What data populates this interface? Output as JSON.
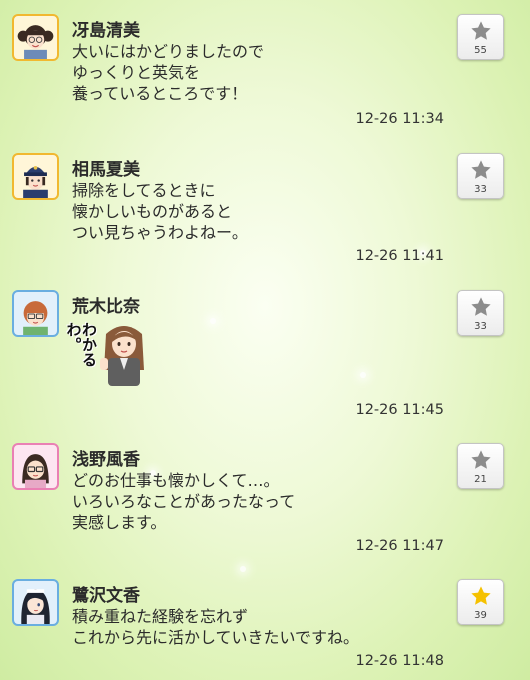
{
  "posts": [
    {
      "name": "冴島清美",
      "lines": [
        "大いにはかどりましたので",
        "ゆっくりと英気を",
        "養っているところです！"
      ],
      "time": "12-26 11:34",
      "likes": "55",
      "liked": false,
      "avatar_icon": "avatar-glasses-twintails"
    },
    {
      "name": "相馬夏美",
      "lines": [
        "掃除をしてるときに",
        "懐かしいものがあると",
        "つい見ちゃうわよねー。"
      ],
      "time": "12-26 11:41",
      "likes": "33",
      "liked": false,
      "avatar_icon": "avatar-pilot-cap"
    },
    {
      "name": "荒木比奈",
      "sticker_text": "わかるわ。",
      "time": "12-26 11:45",
      "likes": "33",
      "liked": false,
      "avatar_icon": "avatar-glasses-ponytail"
    },
    {
      "name": "浅野風香",
      "lines": [
        "どのお仕事も懐かしくて…。",
        "いろいろなことがあったなって",
        "実感します。"
      ],
      "time": "12-26 11:47",
      "likes": "21",
      "liked": false,
      "avatar_icon": "avatar-glasses-long-hair"
    },
    {
      "name": "鷺沢文香",
      "lines": [
        "積み重ねた経験を忘れず",
        "これから先に活かしていきたいですね。"
      ],
      "time": "12-26 11:48",
      "likes": "39",
      "liked": true,
      "avatar_icon": "avatar-long-black-hair"
    }
  ],
  "colors": {
    "star_default": "#8c8c8c",
    "star_liked": "#f5c100",
    "text": "#2b2b2b"
  }
}
